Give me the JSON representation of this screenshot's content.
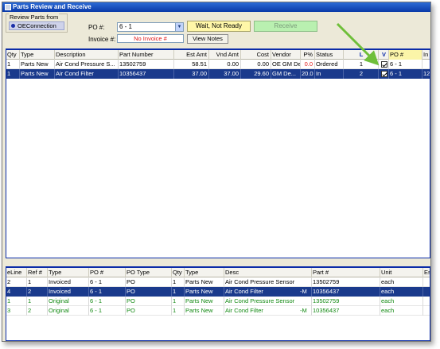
{
  "window": {
    "title": "Parts Review and Receive"
  },
  "review": {
    "group_label": "Review Parts from",
    "option": "OEConnection"
  },
  "po": {
    "label": "PO #:",
    "value": "6 - 1"
  },
  "invoice": {
    "label": "Invoice #:",
    "value": "No Invoice #"
  },
  "buttons": {
    "wait": "Wait, Not Ready",
    "receive": "Receive",
    "view_notes": "View Notes"
  },
  "parts_grid": {
    "columns": [
      "Qty",
      "Type",
      "Description",
      "Part Number",
      "Est Amt",
      "Vnd Amt",
      "Cost",
      "Vendor",
      "P%",
      "Status",
      "L",
      "V",
      "PO #",
      "In"
    ],
    "rows": [
      {
        "qty": "1",
        "type": "Parts New",
        "description": "Air Cond Pressure S...",
        "part_number": "13502759",
        "est_amt": "58.51",
        "vnd_amt": "0.00",
        "cost": "0.00",
        "vendor": "OE GM De...",
        "pct": "0.0",
        "status": "Ordered",
        "l": "1",
        "v_checked": true,
        "po": "6 - 1",
        "in": ""
      },
      {
        "qty": "1",
        "type": "Parts New",
        "description": "Air Cond Filter",
        "part_number": "10356437",
        "est_amt": "37.00",
        "vnd_amt": "37.00",
        "cost": "29.60",
        "vendor": "GM De...",
        "pct": "20.0",
        "status": "In",
        "l": "2",
        "v_checked": true,
        "po": "6 - 1",
        "in": "12"
      }
    ]
  },
  "invoice_grid": {
    "columns": [
      "eLine",
      "Ref #",
      "Type",
      "PO #",
      "PO Type",
      "Qty",
      "Type",
      "Desc",
      "Part #",
      "Unit",
      "Es"
    ],
    "rows": [
      {
        "eline": "2",
        "ref": "1",
        "type": "Invoiced",
        "po": "6 - 1",
        "po_type": "PO",
        "qty": "1",
        "ptype": "Parts New",
        "desc": "Air Cond Pressure Sensor",
        "flag": "",
        "part": "13502759",
        "unit": "each",
        "es": ""
      },
      {
        "eline": "4",
        "ref": "2",
        "type": "Invoiced",
        "po": "6 - 1",
        "po_type": "PO",
        "qty": "1",
        "ptype": "Parts New",
        "desc": "Air Cond Filter",
        "flag": "-M",
        "part": "10356437",
        "unit": "each",
        "es": ""
      },
      {
        "eline": "1",
        "ref": "1",
        "type": "Original",
        "po": "6 - 1",
        "po_type": "PO",
        "qty": "1",
        "ptype": "Parts New",
        "desc": "Air Cond Pressure Sensor",
        "flag": "",
        "part": "13502759",
        "unit": "each",
        "es": ""
      },
      {
        "eline": "3",
        "ref": "2",
        "type": "Original",
        "po": "6 - 1",
        "po_type": "PO",
        "qty": "1",
        "ptype": "Parts New",
        "desc": "Air Cond Filter",
        "flag": "-M",
        "part": "10356437",
        "unit": "each",
        "es": ""
      }
    ]
  },
  "colors": {
    "accent": "#1a3a8c",
    "original_text": "#138a13",
    "arrow": "#6fbf3a"
  }
}
